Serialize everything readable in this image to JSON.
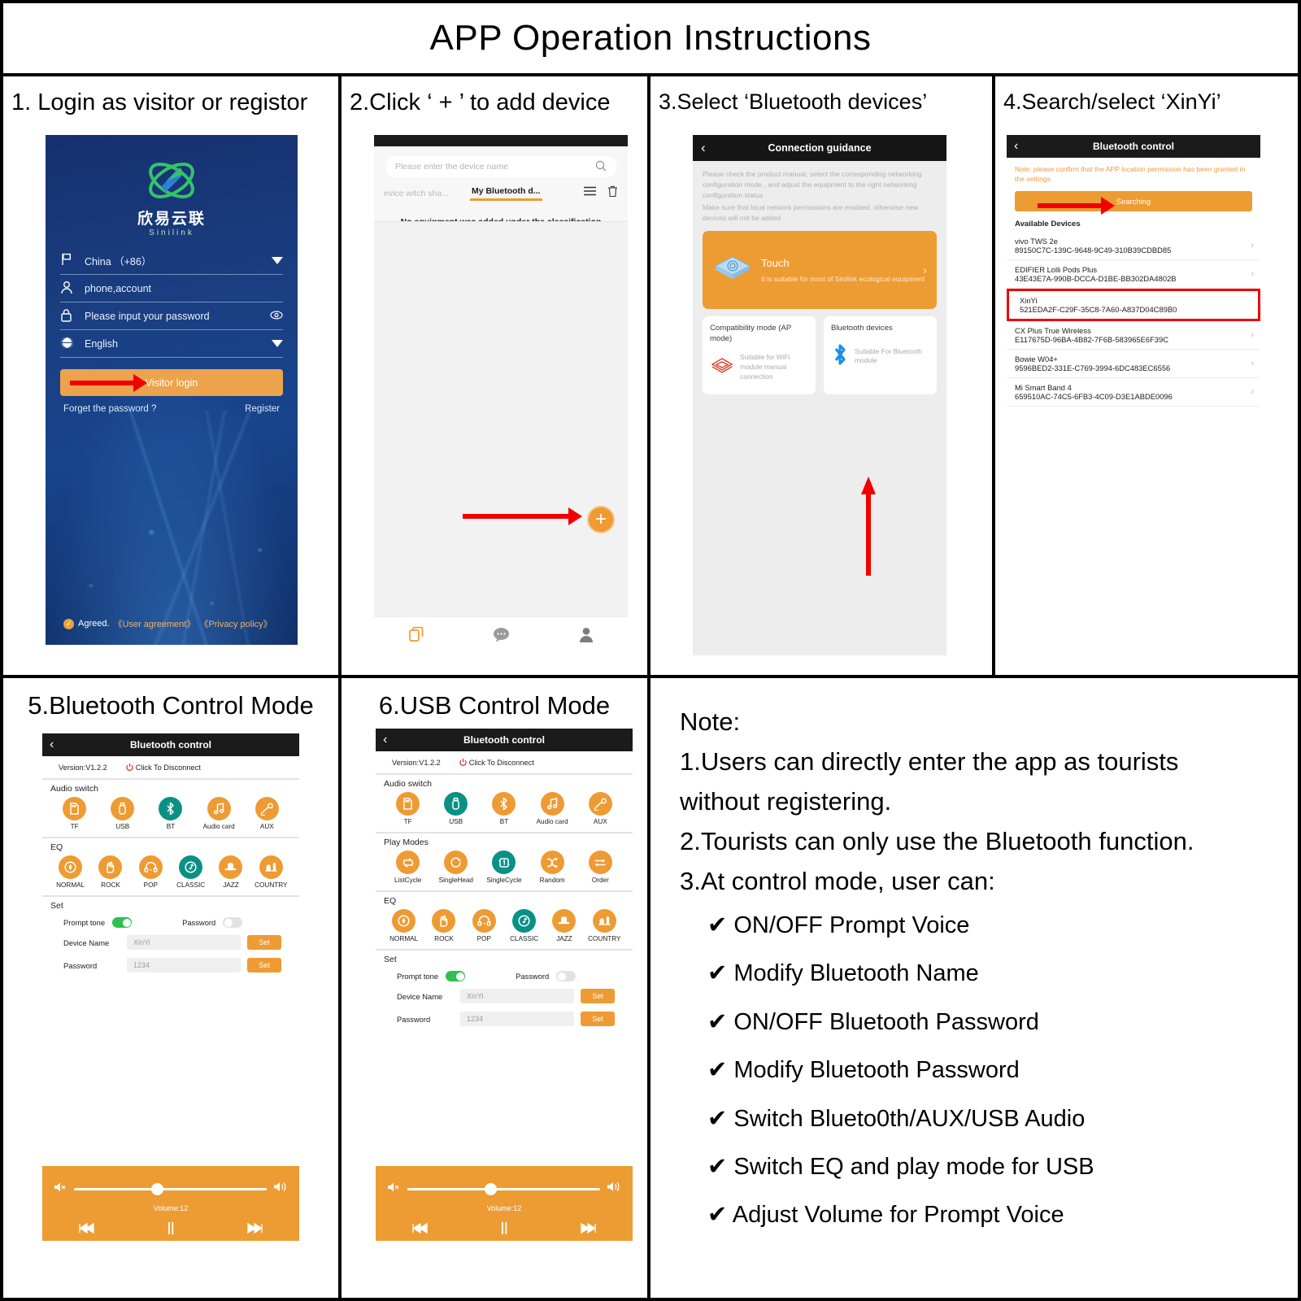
{
  "title": "APP Operation Instructions",
  "panels": {
    "p1": {
      "caption": "1. Login as visitor or registor"
    },
    "p2": {
      "caption": "2.Click ‘ + ’ to add device"
    },
    "p3": {
      "caption": "3.Select  ‘Bluetooth devices’"
    },
    "p4": {
      "caption": "4.Search/select ‘XinYi’"
    },
    "p5": {
      "caption": "5.Bluetooth Control Mode"
    },
    "p6": {
      "caption": "6.USB Control Mode"
    }
  },
  "login": {
    "brand_cn": "欣易云联",
    "brand_en": "Sinilink",
    "country": "China （+86）",
    "account_placeholder": "phone,account",
    "password_placeholder": "Please input your password",
    "language": "English",
    "visitor_login": "Visitor login",
    "forget": "Forget the password ?",
    "register": "Register",
    "agreed": "Agreed.",
    "user_agreement": "《User agreement》",
    "privacy_policy": "《Privacy policy》"
  },
  "devices_page": {
    "search_placeholder": "Please enter the device name",
    "tab_inactive": "evice witch sha...",
    "tab_active": "My Bluetooth d...",
    "empty_text": "No equipment was added under the classification",
    "plus": "+",
    "nav": [
      "devices-icon",
      "message-icon",
      "profile-icon"
    ]
  },
  "guidance": {
    "title": "Connection guidance",
    "intro_1": "Please check the product manual, select the corresponding networking configuration mode , and adjust the equipment to the right networking configuration status",
    "intro_2": "Make sure that local network permissions are enabled, otherwise new devices will not be added",
    "touch_title": "Touch",
    "touch_sub": "It is suitable for most of Sinilink ecological equipment",
    "ap_title": "Compatibility mode (AP mode)",
    "ap_sub": "Suitable for WiFi module manual connection",
    "bt_title": "Bluetooth devices",
    "bt_sub": "Suitable For Bluetooth module"
  },
  "bt_scan": {
    "title": "Bluetooth control",
    "note": "Note:  please confirm that the APP location permission has been granted in the settings",
    "searching": "Searching",
    "available": "Available Devices",
    "devices": [
      {
        "name": "vivo TWS 2e",
        "mac": "89150C7C-139C-9648-9C49-310B39CDBD85",
        "highlight": false
      },
      {
        "name": "EDIFIER Lolli Pods Plus",
        "mac": "43E43E7A-990B-DCCA-D1BE-BB302DA4802B",
        "highlight": false
      },
      {
        "name": "XinYi",
        "mac": "521EDA2F-C29F-35C8-7A60-A837D04C89B0",
        "highlight": true
      },
      {
        "name": "CX Plus True Wireless",
        "mac": "E117675D-96BA-4B82-7F6B-583965E6F39C",
        "highlight": false
      },
      {
        "name": "Bowie W04+",
        "mac": "9596BED2-331E-C769-3994-6DC483EC6556",
        "highlight": false
      },
      {
        "name": "Mi Smart Band 4",
        "mac": "659510AC-74C5-6FB3-4C09-D3E1ABDE0096",
        "highlight": false
      }
    ]
  },
  "control": {
    "title": "Bluetooth control",
    "version": "Version:V1.2.2",
    "disconnect": "Click To Disconnect",
    "audio_switch_label": "Audio switch",
    "audio_switch": [
      {
        "label": "TF",
        "icon": "tf-card-icon",
        "active": false
      },
      {
        "label": "USB",
        "icon": "usb-stick-icon",
        "active": false
      },
      {
        "label": "BT",
        "icon": "bluetooth-icon",
        "active": true
      },
      {
        "label": "Audio card",
        "icon": "music-note-icon",
        "active": false
      },
      {
        "label": "AUX",
        "icon": "aux-cable-icon",
        "active": false
      }
    ],
    "audio_switch_usb": [
      {
        "label": "TF",
        "icon": "tf-card-icon",
        "active": false
      },
      {
        "label": "USB",
        "icon": "usb-stick-icon",
        "active": true
      },
      {
        "label": "BT",
        "icon": "bluetooth-icon",
        "active": false
      },
      {
        "label": "Audio card",
        "icon": "music-note-icon",
        "active": false
      },
      {
        "label": "AUX",
        "icon": "aux-cable-icon",
        "active": false
      }
    ],
    "play_modes_label": "Play Modes",
    "play_modes": [
      {
        "label": "ListCycle",
        "icon": "list-cycle-icon",
        "active": false
      },
      {
        "label": "SingleHead",
        "icon": "single-head-icon",
        "active": false
      },
      {
        "label": "SingleCycle",
        "icon": "single-cycle-icon",
        "active": true
      },
      {
        "label": "Random",
        "icon": "shuffle-icon",
        "active": false
      },
      {
        "label": "Order",
        "icon": "order-icon",
        "active": false
      }
    ],
    "eq_label": "EQ",
    "eq": [
      {
        "label": "NORMAL",
        "icon": "normal-eq-icon",
        "active": false
      },
      {
        "label": "ROCK",
        "icon": "rock-hand-icon",
        "active": false
      },
      {
        "label": "POP",
        "icon": "headphones-icon",
        "active": false
      },
      {
        "label": "CLASSIC",
        "icon": "classic-note-icon",
        "active": true
      },
      {
        "label": "JAZZ",
        "icon": "jazz-hat-icon",
        "active": false
      },
      {
        "label": "COUNTRY",
        "icon": "country-icon",
        "active": false
      }
    ],
    "set_label": "Set",
    "prompt_tone_label": "Prompt tone",
    "prompt_tone_on": true,
    "password_toggle_label": "Password",
    "password_toggle_on": false,
    "device_name_label": "Device Name",
    "device_name_value": "XinYi",
    "password_label": "Password",
    "password_value": "1234",
    "set_button": "Set",
    "volume_label": "Volume:12"
  },
  "note": {
    "heading": "Note:",
    "lines": [
      "1.Users can directly enter the app as tourists",
      "without registering.",
      "2.Tourists can only use the Bluetooth function.",
      "3.At control mode, user can:"
    ],
    "bullets": [
      "✔ ON/OFF Prompt Voice",
      "✔ Modify Bluetooth Name",
      "✔ ON/OFF Bluetooth Password",
      "✔ Modify Bluetooth Password",
      "✔ Switch Blueto0th/AUX/USB Audio",
      "✔ Switch EQ and play mode for USB",
      "✔ Adjust Volume for Prompt Voice"
    ]
  },
  "colors": {
    "orange": "#ED9C33",
    "teal": "#0A9186",
    "red": "#F10000",
    "green": "#2FC04E"
  }
}
